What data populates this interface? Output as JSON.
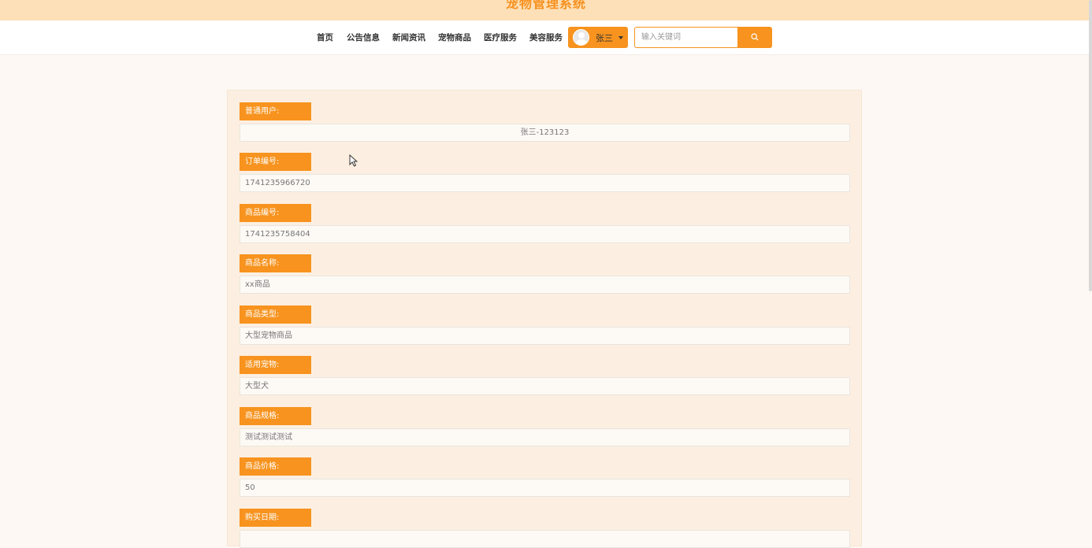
{
  "header": {
    "site_title": "宠物管理系统"
  },
  "nav": {
    "items": [
      "首页",
      "公告信息",
      "新闻资讯",
      "宠物商品",
      "医疗服务",
      "美容服务"
    ]
  },
  "user_menu": {
    "username": "张三"
  },
  "search": {
    "placeholder": "输入关键词"
  },
  "form": {
    "fields": [
      {
        "label": "普通用户:",
        "value": "张三-123123"
      },
      {
        "label": "订单编号:",
        "value": "1741235966720"
      },
      {
        "label": "商品编号:",
        "value": "1741235758404"
      },
      {
        "label": "商品名称:",
        "value": "xx商品"
      },
      {
        "label": "商品类型:",
        "value": "大型宠物商品"
      },
      {
        "label": "适用宠物:",
        "value": "大型犬"
      },
      {
        "label": "商品规格:",
        "value": "测试测试测试"
      },
      {
        "label": "商品价格:",
        "value": "50"
      },
      {
        "label": "购买日期:",
        "value": ""
      }
    ]
  },
  "colors": {
    "accent": "#f7931e",
    "topbar": "#fde0b8",
    "panel": "#fcefe1"
  },
  "icons": [
    "search-icon",
    "avatar",
    "chevron-down-icon",
    "mouse-pointer-icon"
  ]
}
